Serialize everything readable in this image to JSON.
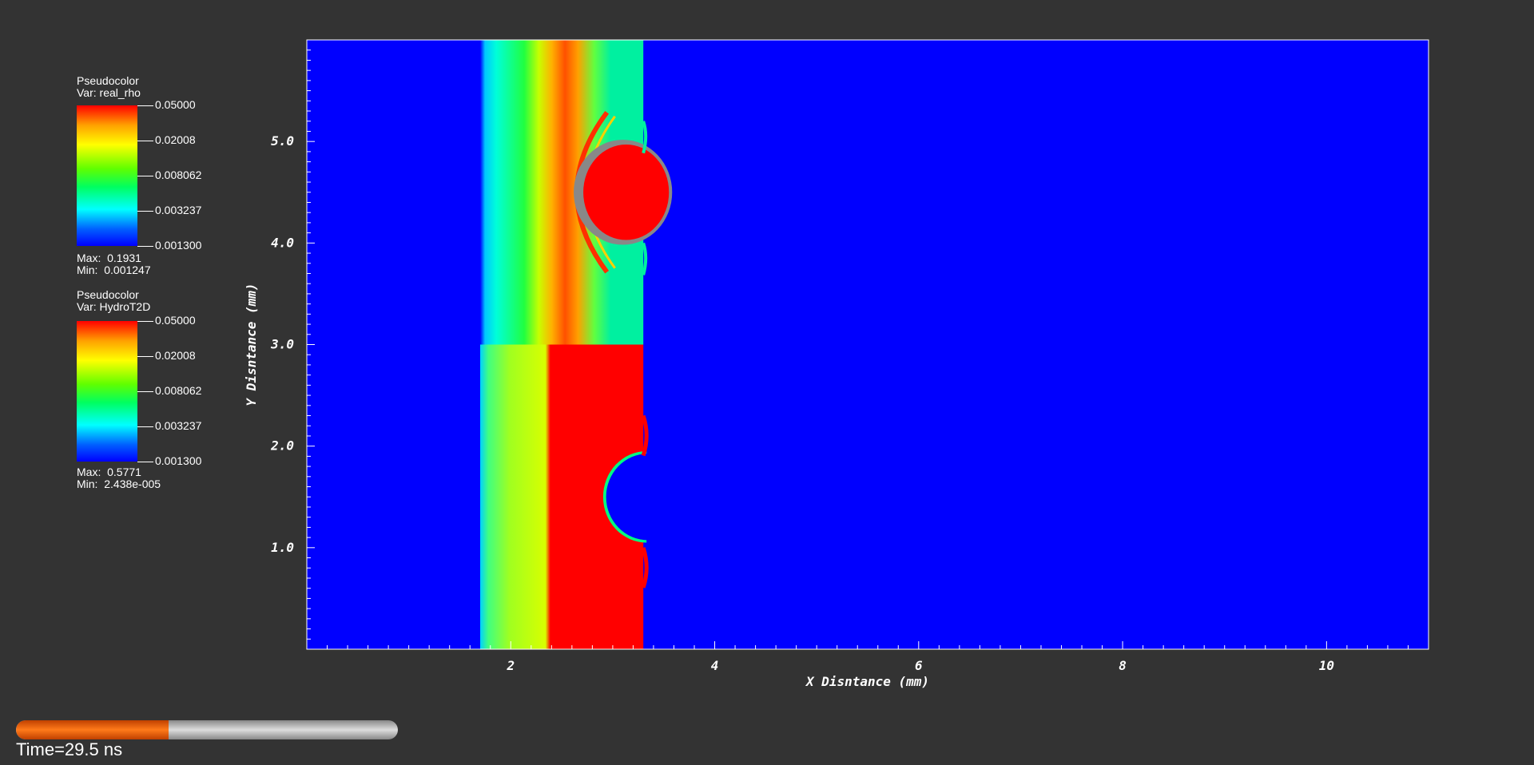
{
  "legends": [
    {
      "plot_type": "Pseudocolor",
      "var_label": "Var: real_rho",
      "tick_labels": [
        "0.05000",
        "0.02008",
        "0.008062",
        "0.003237",
        "0.001300"
      ],
      "max_label": "Max:  0.1931",
      "min_label": "Min:  0.001247"
    },
    {
      "plot_type": "Pseudocolor",
      "var_label": "Var: HydroT2D",
      "tick_labels": [
        "0.05000",
        "0.02008",
        "0.008062",
        "0.003237",
        "0.001300"
      ],
      "max_label": "Max:  0.5771",
      "min_label": "Min:  2.438e-005"
    }
  ],
  "time": {
    "label": "Time=29.5 ns",
    "progress": 0.4
  },
  "colors": {
    "background": "#333333",
    "field_blue": "#0000ff",
    "red": "#ff0000",
    "yellow_green": "#c8ff00",
    "cyan_green": "#00f0a0",
    "progress_orange": "#ff6a00"
  },
  "chart_data": {
    "type": "heatmap",
    "xlabel": "X Disntance (mm)",
    "ylabel": "Y Disntance (mm)",
    "xlim": [
      0,
      11
    ],
    "ylim": [
      0,
      6
    ],
    "x_ticks": [
      "2",
      "4",
      "6",
      "8",
      "10"
    ],
    "x_tick_values": [
      2,
      4,
      6,
      8,
      10
    ],
    "y_ticks": [
      "1.0",
      "2.0",
      "3.0",
      "4.0",
      "5.0"
    ],
    "y_tick_values": [
      1,
      2,
      3,
      4,
      5
    ],
    "regions": {
      "upper_half": {
        "y_range": [
          3,
          6
        ],
        "x_range": [
          1.7,
          3.3
        ],
        "variable": "real_rho"
      },
      "lower_half": {
        "y_range": [
          0,
          3
        ],
        "x_range": [
          1.7,
          3.3
        ],
        "variable": "HydroT2D"
      },
      "upper_blob_center": [
        3.1,
        4.5
      ],
      "lower_cavity_center": [
        3.3,
        1.5
      ]
    }
  }
}
